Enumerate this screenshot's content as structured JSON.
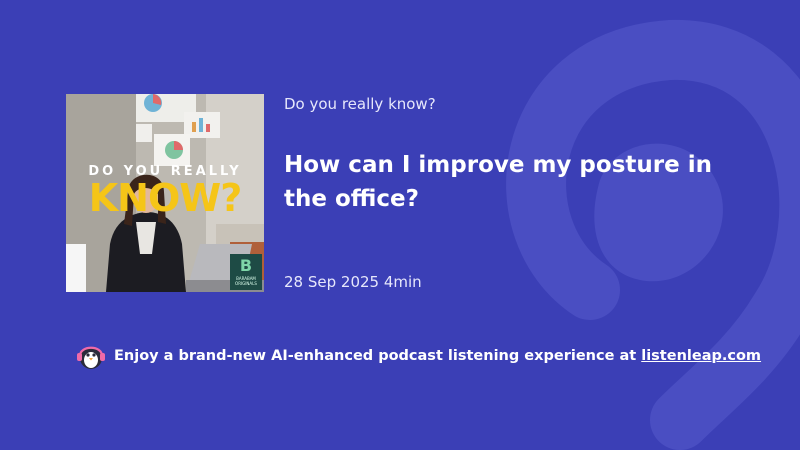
{
  "colors": {
    "background": "#3b3fb6",
    "cover_accent": "#f5c518",
    "text": "#ffffff"
  },
  "cover": {
    "line1": "DO YOU REALLY",
    "line2": "KNOW?",
    "badge_mark": "B",
    "badge_text": "BARABAM ORIGINALS"
  },
  "podcast": {
    "show_title": "Do you really know?",
    "episode_title": "How can I improve my posture in the office?",
    "date": "28 Sep 2025",
    "duration": "4min"
  },
  "promo": {
    "icon": "penguin-headphones-icon",
    "text": "Enjoy a brand-new AI-enhanced podcast listening experience at",
    "link_text": "listenleap.com"
  }
}
